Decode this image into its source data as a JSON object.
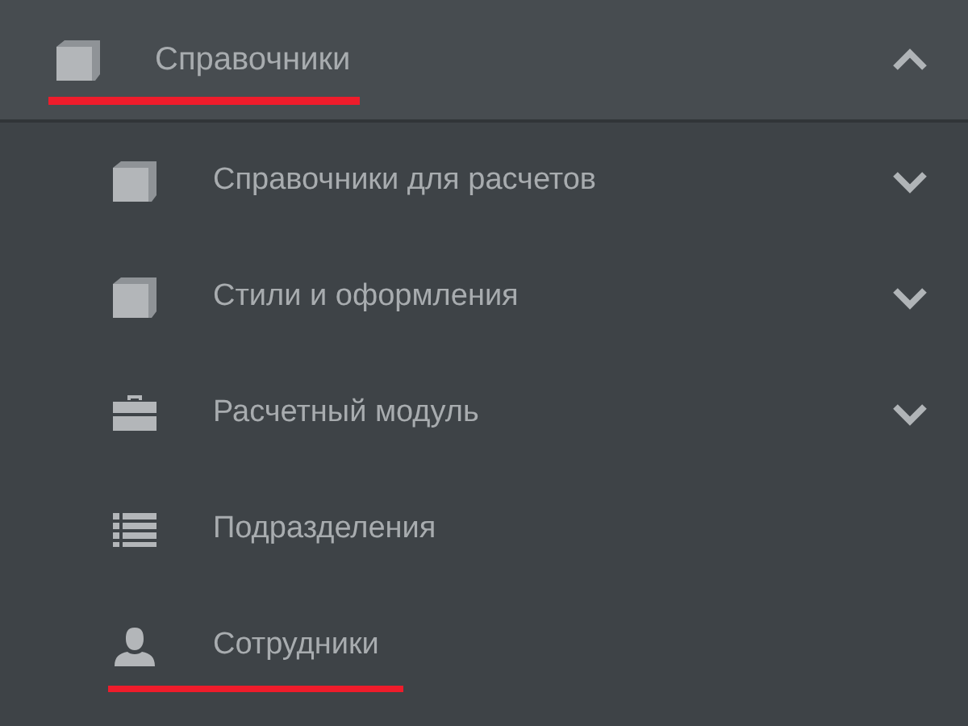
{
  "menu": {
    "label": "Справочники",
    "selected": true,
    "expanded": true,
    "items": [
      {
        "kind": "submenu",
        "label": "Справочники для расчетов",
        "selected": false,
        "expanded": false
      },
      {
        "kind": "submenu",
        "label": "Стили и оформления",
        "selected": false,
        "expanded": false
      },
      {
        "kind": "submenu",
        "label": "Расчетный модуль",
        "selected": false,
        "expanded": false
      },
      {
        "kind": "link",
        "label": "Подразделения",
        "selected": false
      },
      {
        "kind": "link",
        "label": "Сотрудники",
        "selected": true
      }
    ]
  }
}
